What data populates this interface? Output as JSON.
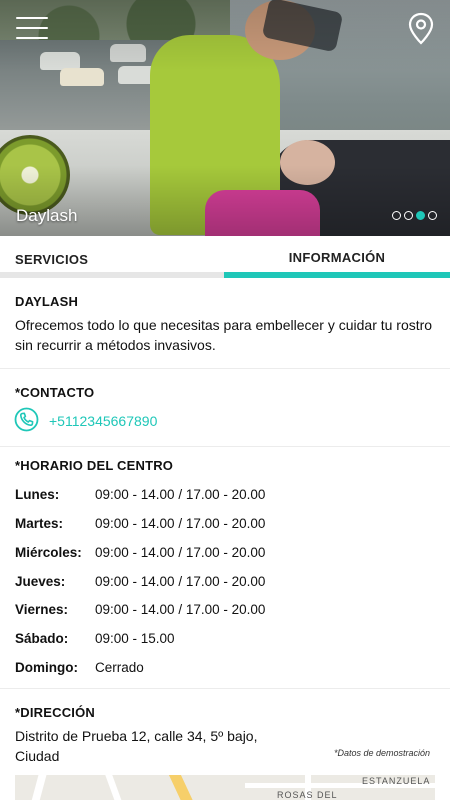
{
  "hero": {
    "title": "Daylash",
    "slides": [
      false,
      false,
      true,
      false
    ]
  },
  "tabs": [
    {
      "label": "SERVICIOS",
      "active": false
    },
    {
      "label": "INFORMACIÓN",
      "active": true
    }
  ],
  "description": {
    "heading": "DAYLASH",
    "text": "Ofrecemos todo lo que necesitas para embellecer y cuidar tu rostro sin recurrir a métodos invasivos."
  },
  "contact": {
    "heading": "*CONTACTO",
    "phone": "+5112345667890"
  },
  "hours": {
    "heading": "*HORARIO DEL CENTRO",
    "days": [
      {
        "day": "Lunes:",
        "time": "09:00 - 14.00  /  17.00 - 20.00"
      },
      {
        "day": "Martes:",
        "time": "09:00 - 14.00  /  17.00 - 20.00"
      },
      {
        "day": "Miércoles:",
        "time": "09:00 - 14.00  /  17.00 - 20.00"
      },
      {
        "day": "Jueves:",
        "time": "09:00 - 14.00  /  17.00 - 20.00"
      },
      {
        "day": "Viernes:",
        "time": "09:00 - 14.00  /  17.00 - 20.00"
      },
      {
        "day": "Sábado:",
        "time": "09:00 - 15.00"
      },
      {
        "day": "Domingo:",
        "time": "Cerrado"
      }
    ]
  },
  "address": {
    "heading": "*DIRECCIÓN",
    "text": "Distrito de Prueba 12, calle 34, 5º bajo, Ciudad",
    "demo_note": "*Datos de demostración",
    "map_labels": [
      "ESTANZUELA",
      "ROSAS DEL"
    ]
  },
  "colors": {
    "accent": "#1fc7b8",
    "tab_inactive": "#e6e6e6"
  },
  "icons": {
    "menu": "hamburger-menu-icon",
    "location": "location-pin-icon",
    "phone": "phone-icon"
  }
}
